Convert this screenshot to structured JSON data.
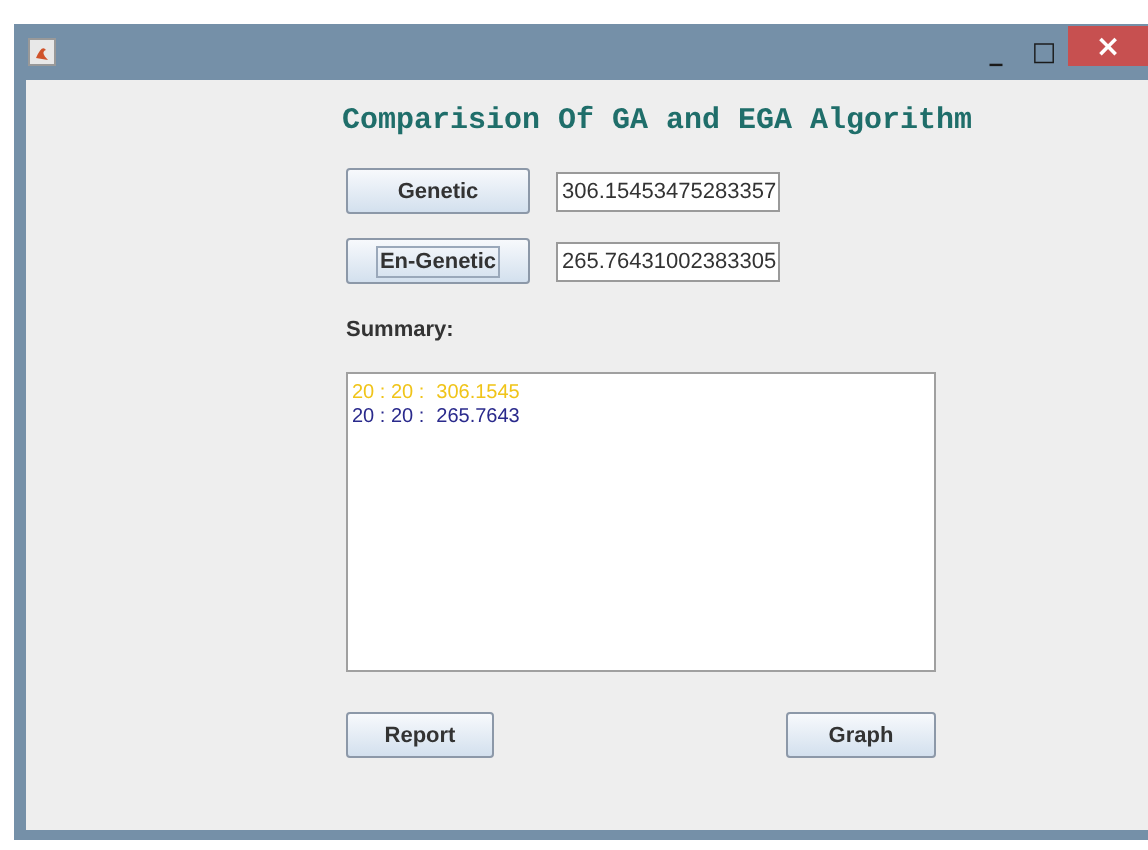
{
  "window": {
    "title_bar_buttons": [
      "_",
      "□",
      "×"
    ]
  },
  "title": "Comparision Of GA and EGA Algorithm",
  "rows": [
    {
      "button": "Genetic",
      "value": "306.15453475283357",
      "focused": false
    },
    {
      "button": "En-Genetic",
      "value": "265.76431002383305",
      "focused": true
    }
  ],
  "summary_label": "Summary:",
  "summary_lines": [
    {
      "label": "20 : 20 :",
      "value": "306.1545",
      "color": "#f0c419"
    },
    {
      "label": "20 : 20 :",
      "value": "265.7643",
      "color": "#2a2a8c"
    }
  ],
  "buttons": [
    "Report",
    "Graph"
  ]
}
